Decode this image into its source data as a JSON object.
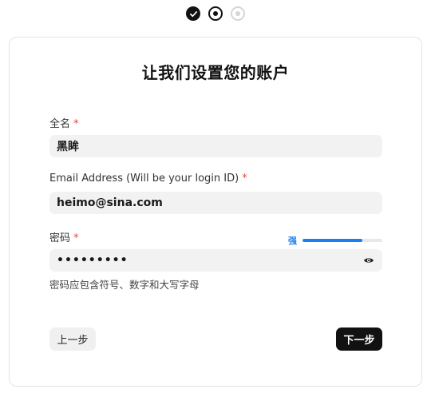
{
  "stepper": {
    "steps": [
      {
        "state": "done",
        "icon": "check-icon"
      },
      {
        "state": "current",
        "icon": "dot-icon"
      },
      {
        "state": "pending",
        "icon": "dot-icon"
      }
    ]
  },
  "form": {
    "title": "让我们设置您的账户",
    "name": {
      "label": "全名",
      "required_mark": "*",
      "value": "黑眸"
    },
    "email": {
      "label": "Email Address (Will be your login ID)",
      "required_mark": "*",
      "value": "heimo@sina.com"
    },
    "password": {
      "label": "密码",
      "required_mark": "*",
      "masked_value": "•••••••••",
      "strength_label": "强",
      "strength_fraction": 0.75,
      "toggle_icon": "eye-icon",
      "hint": "密码应包含符号、数字和大写字母"
    }
  },
  "actions": {
    "back_label": "上一步",
    "next_label": "下一步"
  },
  "colors": {
    "accent": "#1a7ff0",
    "primary": "#111111",
    "required": "#e0483e",
    "field_bg": "#f2f2f2"
  }
}
